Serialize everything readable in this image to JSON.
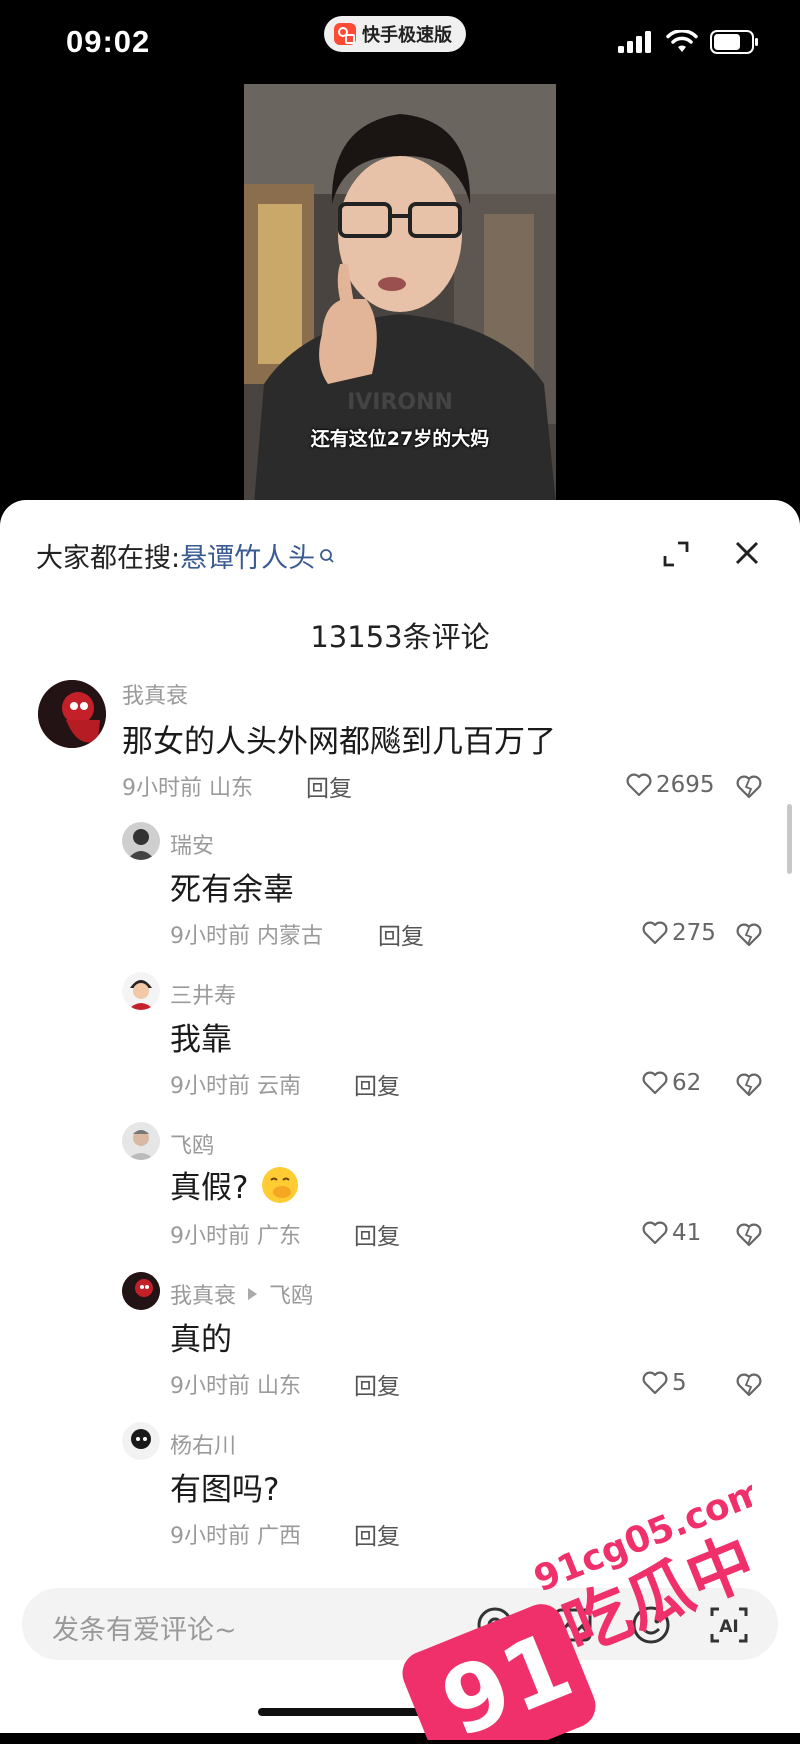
{
  "status_bar": {
    "time": "09:02",
    "app_name": "快手极速版",
    "app_logo_color": "#ff4a36"
  },
  "video": {
    "caption": "还有这位27岁的大妈"
  },
  "sheet": {
    "search_prefix": "大家都在搜:",
    "search_term": "悬谭竹人头",
    "comment_count": "13153条评论"
  },
  "comments": [
    {
      "user": "我真衰",
      "text": "那女的人头外网都飚到几百万了",
      "meta": "9小时前 山东",
      "reply": "回复",
      "likes": "2695",
      "avatar": "spider-avatar"
    },
    {
      "user": "瑞安",
      "text": "死有余辜",
      "meta": "9小时前 内蒙古",
      "reply": "回复",
      "likes": "275",
      "avatar": "bw-avatar"
    },
    {
      "user": "三井寿",
      "text": "我靠",
      "meta": "9小时前 云南",
      "reply": "回复",
      "likes": "62",
      "avatar": "anime-avatar"
    },
    {
      "user": "飞鸥",
      "text": "真假?",
      "emoji": "face-with-hand-over-mouth",
      "meta": "9小时前 广东",
      "reply": "回复",
      "likes": "41",
      "avatar": "person-avatar"
    },
    {
      "user": "我真衰",
      "reply_to": "飞鸥",
      "text": "真的",
      "meta": "9小时前 山东",
      "reply": "回复",
      "likes": "5",
      "avatar": "spider-avatar"
    },
    {
      "user": "杨右川",
      "text": "有图吗?",
      "meta": "9小时前 广西",
      "reply": "回复",
      "likes": "",
      "avatar": "dark-avatar"
    }
  ],
  "input": {
    "placeholder": "发条有爱评论~"
  },
  "watermark": {
    "domain": "91cg05.com",
    "brand": "吃瓜中心",
    "logo_text": "91",
    "color": "#f0306a"
  }
}
